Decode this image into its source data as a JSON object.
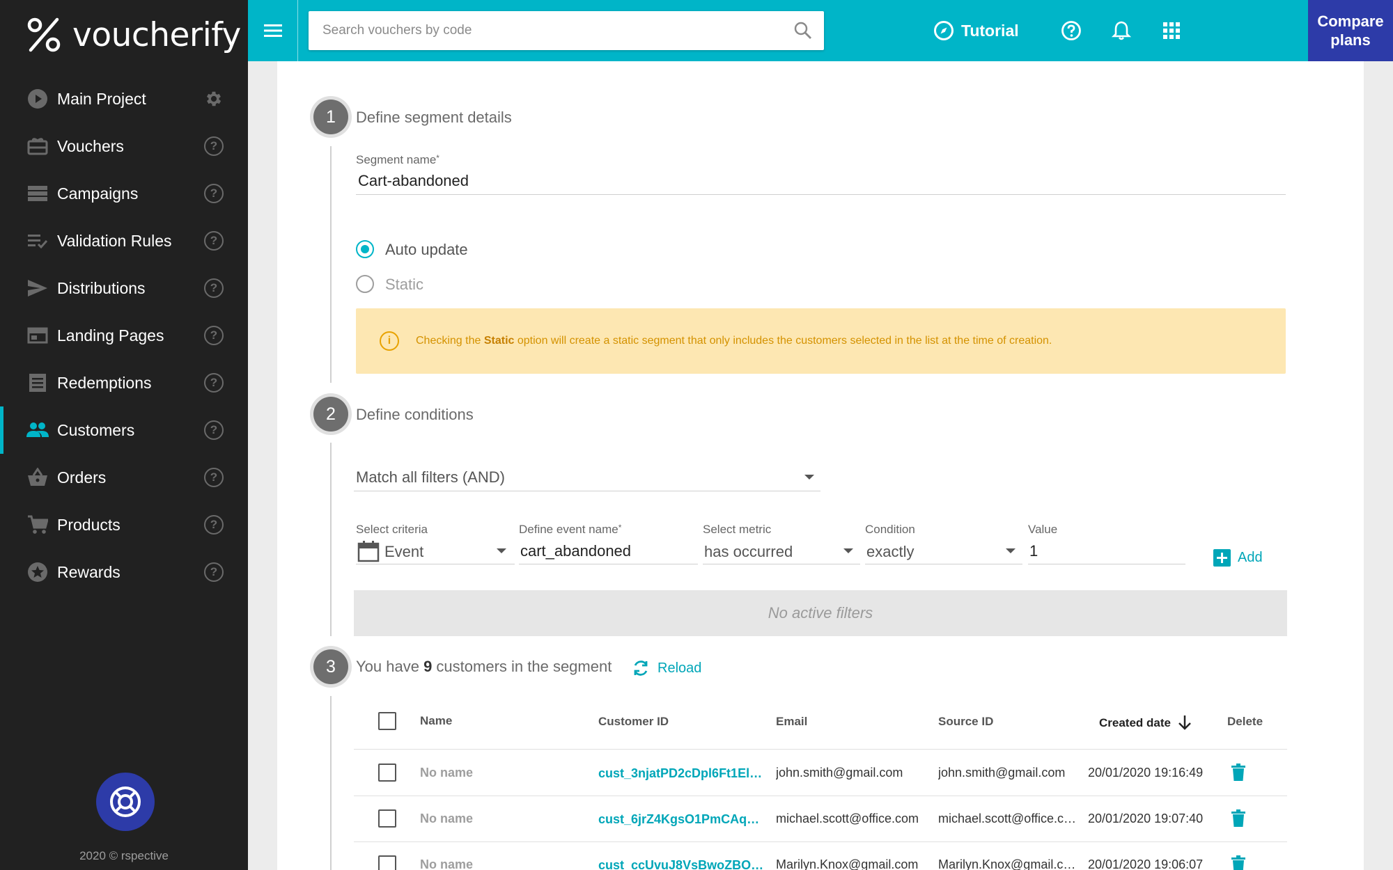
{
  "app": {
    "logo_text": "voucherify",
    "copyright": "2020 © rspective"
  },
  "sidebar": {
    "items": [
      {
        "label": "Main Project",
        "icon": "play-circle-icon",
        "trailing": "gear-icon"
      },
      {
        "label": "Vouchers",
        "icon": "voucher-icon",
        "trailing": "help-icon"
      },
      {
        "label": "Campaigns",
        "icon": "campaigns-icon",
        "trailing": "help-icon"
      },
      {
        "label": "Validation Rules",
        "icon": "rules-icon",
        "trailing": "help-icon"
      },
      {
        "label": "Distributions",
        "icon": "send-icon",
        "trailing": "help-icon"
      },
      {
        "label": "Landing Pages",
        "icon": "browser-icon",
        "trailing": "help-icon"
      },
      {
        "label": "Redemptions",
        "icon": "list-icon",
        "trailing": "help-icon"
      },
      {
        "label": "Customers",
        "icon": "people-icon",
        "trailing": "help-icon",
        "active": true
      },
      {
        "label": "Orders",
        "icon": "basket-icon",
        "trailing": "help-icon"
      },
      {
        "label": "Products",
        "icon": "cart-icon",
        "trailing": "help-icon"
      },
      {
        "label": "Rewards",
        "icon": "star-icon",
        "trailing": "help-icon"
      }
    ]
  },
  "topbar": {
    "search_placeholder": "Search vouchers by code",
    "tutorial_label": "Tutorial",
    "compare_line1": "Compare",
    "compare_line2": "plans"
  },
  "step1": {
    "number": "1",
    "title": "Define segment details",
    "segment_name_label": "Segment name",
    "required_mark": "*",
    "segment_name_value": "Cart-abandoned",
    "radio_auto": "Auto update",
    "radio_static": "Static",
    "notice_pre": "Checking the ",
    "notice_bold": "Static",
    "notice_post": " option will create a static segment that only includes the customers selected in the list at the time of creation."
  },
  "step2": {
    "number": "2",
    "title": "Define conditions",
    "match_value": "Match all filters (AND)",
    "criteria_label": "Select criteria",
    "criteria_value": "Event",
    "event_label": "Define event name",
    "event_value": "cart_abandoned",
    "metric_label": "Select metric",
    "metric_value": "has occurred",
    "condition_label": "Condition",
    "condition_value": "exactly",
    "value_label": "Value",
    "value_value": "1",
    "add_label": "Add",
    "no_filters": "No active filters"
  },
  "step3": {
    "number": "3",
    "title_pre": "You have ",
    "count": "9",
    "title_post": " customers in the segment",
    "reload_label": "Reload"
  },
  "table": {
    "headers": {
      "name": "Name",
      "customer_id": "Customer ID",
      "email": "Email",
      "source_id": "Source ID",
      "created": "Created date",
      "delete": "Delete"
    },
    "rows": [
      {
        "name": "No name",
        "customer_id": "cust_3njatPD2cDpl6Ft1El…",
        "email": "john.smith@gmail.com",
        "source_id": "john.smith@gmail.com",
        "created": "20/01/2020 19:16:49"
      },
      {
        "name": "No name",
        "customer_id": "cust_6jrZ4KgsO1PmCAqe…",
        "email": "michael.scott@office.com",
        "source_id": "michael.scott@office.c…",
        "created": "20/01/2020 19:07:40"
      },
      {
        "name": "No name",
        "customer_id": "cust_ccUvuJ8VsBwoZBO…",
        "email": "Marilyn.Knox@gmail.com",
        "source_id": "Marilyn.Knox@gmail.com",
        "created": "20/01/2020 19:06:07"
      }
    ]
  },
  "colors": {
    "accent": "#00b5c8",
    "brand_dark": "#2d3ba8",
    "sidebar_bg": "#212121",
    "notice_bg": "#fde7b2"
  }
}
